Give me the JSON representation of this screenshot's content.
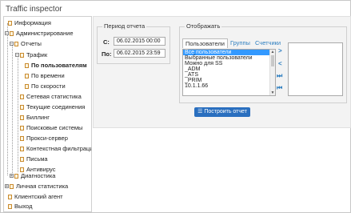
{
  "title": "Traffic inspector",
  "nav": {
    "info": "Информация",
    "admin": "Администрирование",
    "reports": "Отчеты",
    "traffic": "Трафик",
    "by_users": "По пользователям",
    "by_time": "По времени",
    "by_speed": "По скорости",
    "net_stats": "Сетевая статистика",
    "connections": "Текущие соединения",
    "billing": "Биллинг",
    "search": "Поисковые системы",
    "proxy": "Прокси-сервер",
    "content": "Контекстная фильтрация",
    "mail": "Письма",
    "antivirus": "Антивирус",
    "diagnostics": "Диагностика",
    "personal": "Личная статистика",
    "client": "Клиентский агент",
    "exit": "Выход"
  },
  "period": {
    "legend": "Период отчета",
    "from_label": "С:",
    "from_value": "06.02.2015 00:00",
    "to_label": "По:",
    "to_value": "06.02.2015 23:59"
  },
  "display": {
    "legend": "Отображать",
    "tabs": [
      "Пользователи",
      "Группы",
      "Счетчики"
    ],
    "items": [
      "Все пользователи",
      "Выбранные пользователи",
      "Можно для SS",
      "_ADM",
      "_ATS",
      "_PRIM",
      "10.1.1.66"
    ]
  },
  "button_label": "Построить отчет",
  "colors": {
    "accent": "#2a6fbf",
    "selection": "#3399ff"
  }
}
